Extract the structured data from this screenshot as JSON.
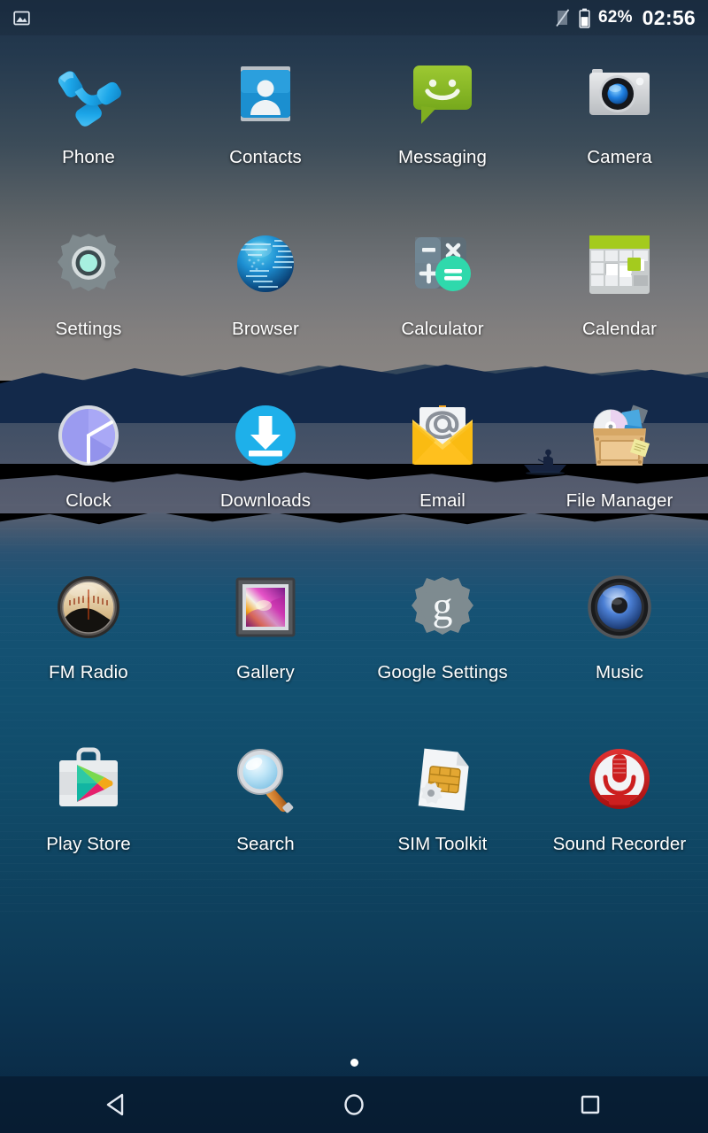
{
  "status_bar": {
    "notification_icon": "image-icon",
    "signal_icon": "no-signal-icon",
    "battery_icon": "battery-icon",
    "battery_percent": "62%",
    "clock": "02:56"
  },
  "home_screen": {
    "page_indicator": {
      "total_pages": 1,
      "current_page": 1
    },
    "apps": [
      {
        "label": "Phone",
        "icon": "phone-icon"
      },
      {
        "label": "Contacts",
        "icon": "contacts-icon"
      },
      {
        "label": "Messaging",
        "icon": "messaging-icon"
      },
      {
        "label": "Camera",
        "icon": "camera-icon"
      },
      {
        "label": "Settings",
        "icon": "settings-gear-icon"
      },
      {
        "label": "Browser",
        "icon": "browser-globe-icon"
      },
      {
        "label": "Calculator",
        "icon": "calculator-icon"
      },
      {
        "label": "Calendar",
        "icon": "calendar-icon"
      },
      {
        "label": "Clock",
        "icon": "clock-icon"
      },
      {
        "label": "Downloads",
        "icon": "download-icon"
      },
      {
        "label": "Email",
        "icon": "email-envelope-icon"
      },
      {
        "label": "File Manager",
        "icon": "file-manager-crate-icon"
      },
      {
        "label": "FM Radio",
        "icon": "fm-radio-dial-icon"
      },
      {
        "label": "Gallery",
        "icon": "gallery-photo-icon"
      },
      {
        "label": "Google Settings",
        "icon": "google-settings-gear-icon"
      },
      {
        "label": "Music",
        "icon": "music-speaker-icon"
      },
      {
        "label": "Play Store",
        "icon": "play-store-bag-icon"
      },
      {
        "label": "Search",
        "icon": "search-magnifier-icon"
      },
      {
        "label": "SIM Toolkit",
        "icon": "sim-toolkit-icon"
      },
      {
        "label": "Sound Recorder",
        "icon": "microphone-icon"
      }
    ]
  },
  "nav_bar": {
    "buttons": [
      {
        "name": "back",
        "icon": "back-triangle-icon"
      },
      {
        "name": "home",
        "icon": "home-circle-icon"
      },
      {
        "name": "recents",
        "icon": "recents-square-icon"
      }
    ]
  },
  "colors": {
    "wallpaper_sky_top": "#1d3147",
    "wallpaper_horizon": "#8a8683",
    "wallpaper_water": "#125070",
    "label_text": "#ffffff",
    "accent_blue": "#2196d4",
    "accent_green": "#8cbf26",
    "accent_red": "#cc1f1f"
  }
}
